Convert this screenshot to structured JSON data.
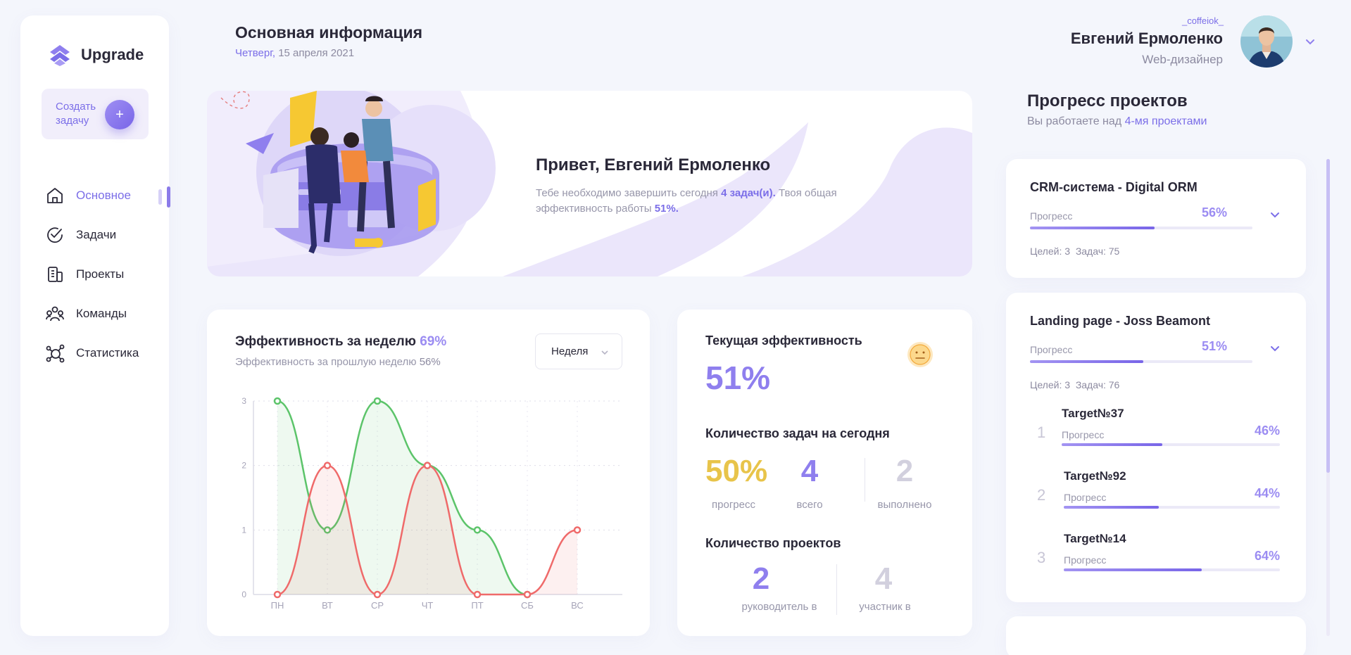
{
  "app": {
    "name": "Upgrade",
    "accent": "#7b6ee8"
  },
  "sidebar": {
    "create_button": "Создать задачу",
    "items": [
      {
        "label": "Основное",
        "icon": "home-icon",
        "active": true
      },
      {
        "label": "Задачи",
        "icon": "check-circle-icon",
        "active": false
      },
      {
        "label": "Проекты",
        "icon": "buildings-icon",
        "active": false
      },
      {
        "label": "Команды",
        "icon": "team-icon",
        "active": false
      },
      {
        "label": "Статистика",
        "icon": "stats-icon",
        "active": false
      }
    ]
  },
  "header": {
    "title": "Основная информация",
    "day": "Четверг,",
    "date": "15 апреля 2021"
  },
  "user": {
    "nick": "_coffeiok_",
    "name": "Евгений Ермоленко",
    "role": "Web-дизайнер"
  },
  "banner": {
    "greeting": "Привет, Евгений Ермоленко",
    "text_1": "Тебе необходимо завершить сегодня",
    "tasks": "4 задач(и).",
    "text_2": "Твоя общая эффективность работы",
    "efficiency": "51%."
  },
  "weekly": {
    "title": "Эффективность за неделю",
    "value": "69%",
    "sub": "Эффективность за прошлую неделю",
    "prev_value": "56%",
    "period": "Неделя"
  },
  "chart_data": {
    "type": "line",
    "categories": [
      "ПН",
      "ВТ",
      "СР",
      "ЧТ",
      "ПТ",
      "СБ",
      "ВС"
    ],
    "y_ticks": [
      "0",
      "1",
      "2",
      "3"
    ],
    "ylim": [
      0,
      3
    ],
    "grid": true,
    "series": [
      {
        "color": "#5cc46a",
        "values": [
          3,
          1,
          3,
          2,
          1,
          0,
          null
        ]
      },
      {
        "color": "#ef6a6a",
        "values": [
          0,
          2,
          0,
          2,
          0,
          0,
          1
        ]
      }
    ]
  },
  "current": {
    "title": "Текущая эффективность",
    "value": "51%",
    "mood_icon": "neutral-face-icon"
  },
  "tasks_today": {
    "title": "Количество задач на сегодня",
    "progress": "50%",
    "progress_label": "прогресс",
    "total": "4",
    "total_label": "всего",
    "done": "2",
    "done_label": "выполнено"
  },
  "projects_count": {
    "title": "Количество проектов",
    "lead": "2",
    "lead_label": "руководитель в",
    "member": "4",
    "member_label": "участник в"
  },
  "progress_panel": {
    "title": "Прогресс проектов",
    "sub": "Вы работаете над",
    "sub_accent": "4-мя проектами",
    "projects": [
      {
        "name": "CRM-система - Digital ORM",
        "progress_label": "Прогресс",
        "progress": "56%",
        "fill": 0.56,
        "goals": "Целей: 3",
        "tasks": "Задач: 75"
      },
      {
        "name": "Landing page - Joss Beamont",
        "progress_label": "Прогресс",
        "progress": "51%",
        "fill": 0.51,
        "goals": "Целей: 3",
        "tasks": "Задач: 76",
        "targets": [
          {
            "num": "1",
            "name": "Target№37",
            "label": "Прогресс",
            "progress": "46%",
            "fill": 0.46
          },
          {
            "num": "2",
            "name": "Target№92",
            "label": "Прогресс",
            "progress": "44%",
            "fill": 0.44
          },
          {
            "num": "3",
            "name": "Target№14",
            "label": "Прогресс",
            "progress": "64%",
            "fill": 0.64
          }
        ]
      }
    ]
  }
}
